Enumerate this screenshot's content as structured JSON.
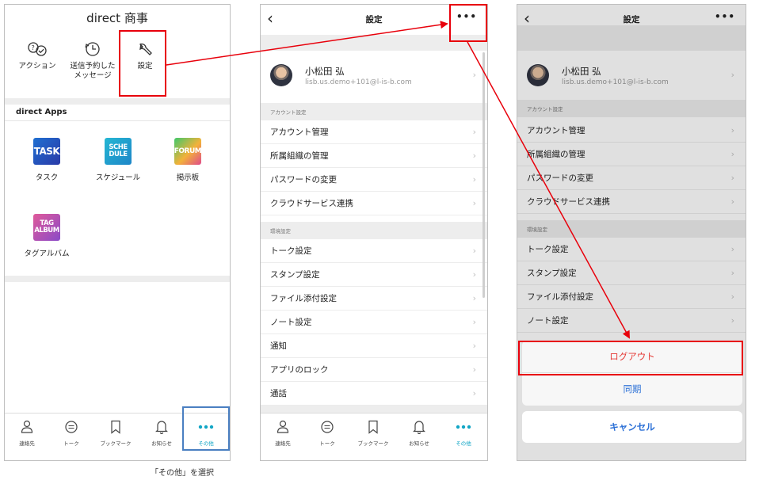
{
  "panel1": {
    "title": "direct 商事",
    "quick_actions": [
      {
        "label": "アクション",
        "icon": "action-icon"
      },
      {
        "label": "送信予約した\nメッセージ",
        "icon": "clock-icon"
      },
      {
        "label": "設定",
        "icon": "wrench-icon"
      }
    ],
    "apps_title": "direct Apps",
    "apps": [
      {
        "label": "タスク",
        "icon_text": "TASK",
        "icon": "task-app-icon"
      },
      {
        "label": "スケジュール",
        "icon_text": "SCHE DULE",
        "icon": "schedule-app-icon"
      },
      {
        "label": "掲示板",
        "icon_text": "FORUM",
        "icon": "forum-app-icon"
      },
      {
        "label": "タグアルバム",
        "icon_text": "TAG ALBUM",
        "icon": "tag-album-app-icon"
      }
    ]
  },
  "tabbar": [
    {
      "label": "連絡先",
      "icon": "person-icon"
    },
    {
      "label": "トーク",
      "icon": "chat-icon"
    },
    {
      "label": "ブックマーク",
      "icon": "bookmark-icon"
    },
    {
      "label": "お知らせ",
      "icon": "bell-icon"
    },
    {
      "label": "その他",
      "icon": "more-dots-icon"
    }
  ],
  "settings": {
    "title": "設定",
    "more": "•••",
    "profile": {
      "name": "小松田 弘",
      "email": "lisb.us.demo+101@l-is-b.com"
    },
    "account_section": "アカウント設定",
    "account_rows": [
      "アカウント管理",
      "所属組織の管理",
      "パスワードの変更",
      "クラウドサービス連携"
    ],
    "env_section": "環境設定",
    "env_rows": [
      "トーク設定",
      "スタンプ設定",
      "ファイル添付設定",
      "ノート設定",
      "通知",
      "アプリのロック",
      "通話"
    ]
  },
  "action_sheet": {
    "logout": "ログアウト",
    "sync": "同期",
    "cancel": "キャンセル"
  },
  "caption": "「その他」を選択",
  "colors": {
    "accent": "#12a6c6",
    "highlight": "#e8000b",
    "logout": "#e53935",
    "sync": "#2a6fd6"
  }
}
